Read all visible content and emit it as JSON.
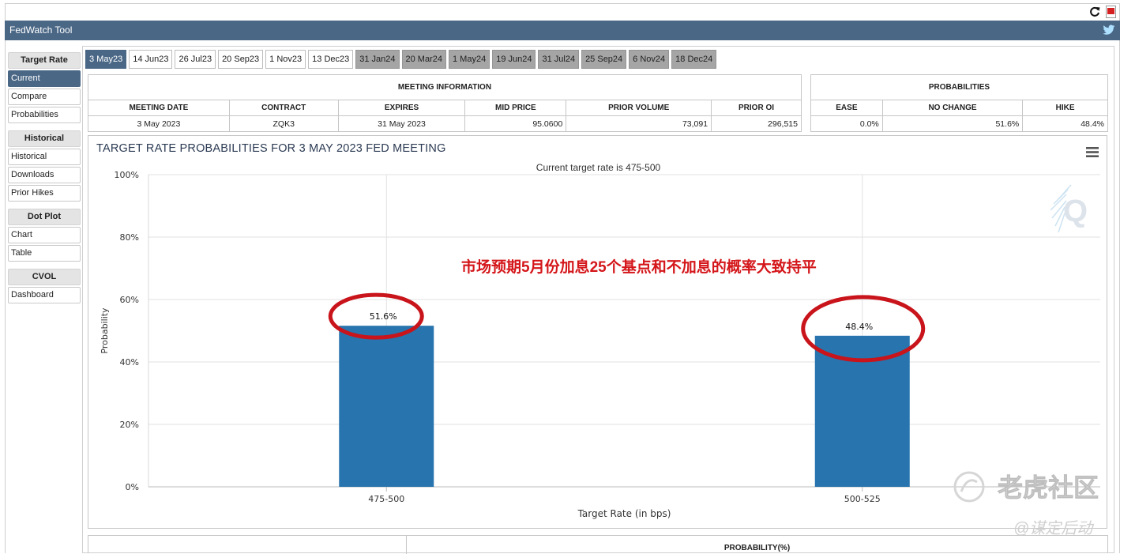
{
  "app": {
    "title": "FedWatch Tool"
  },
  "sidebar": {
    "sections": [
      {
        "heading": "Target Rate",
        "items": [
          {
            "label": "Current",
            "active": true
          },
          {
            "label": "Compare"
          },
          {
            "label": "Probabilities"
          }
        ]
      },
      {
        "heading": "Historical",
        "items": [
          {
            "label": "Historical"
          },
          {
            "label": "Downloads"
          },
          {
            "label": "Prior Hikes"
          }
        ]
      },
      {
        "heading": "Dot Plot",
        "items": [
          {
            "label": "Chart"
          },
          {
            "label": "Table"
          }
        ]
      },
      {
        "heading": "CVOL",
        "items": [
          {
            "label": "Dashboard"
          }
        ]
      }
    ]
  },
  "tabs": [
    {
      "label": "3 May23",
      "state": "active"
    },
    {
      "label": "14 Jun23",
      "state": "normal"
    },
    {
      "label": "26 Jul23",
      "state": "normal"
    },
    {
      "label": "20 Sep23",
      "state": "normal"
    },
    {
      "label": "1 Nov23",
      "state": "normal"
    },
    {
      "label": "13 Dec23",
      "state": "normal"
    },
    {
      "label": "31 Jan24",
      "state": "dim"
    },
    {
      "label": "20 Mar24",
      "state": "dim"
    },
    {
      "label": "1 May24",
      "state": "dim"
    },
    {
      "label": "19 Jun24",
      "state": "dim"
    },
    {
      "label": "31 Jul24",
      "state": "dim"
    },
    {
      "label": "25 Sep24",
      "state": "dim"
    },
    {
      "label": "6 Nov24",
      "state": "dim"
    },
    {
      "label": "18 Dec24",
      "state": "dim"
    }
  ],
  "meeting_info": {
    "heading": "MEETING INFORMATION",
    "columns": [
      "MEETING DATE",
      "CONTRACT",
      "EXPIRES",
      "MID PRICE",
      "PRIOR VOLUME",
      "PRIOR OI"
    ],
    "row": [
      "3 May 2023",
      "ZQK3",
      "31 May 2023",
      "95.0600",
      "73,091",
      "296,515"
    ]
  },
  "probabilities": {
    "heading": "PROBABILITIES",
    "columns": [
      "EASE",
      "NO CHANGE",
      "HIKE"
    ],
    "row": [
      "0.0%",
      "51.6%",
      "48.4%"
    ]
  },
  "chart_data": {
    "type": "bar",
    "title": "TARGET RATE PROBABILITIES FOR 3 MAY 2023 FED MEETING",
    "subtitle": "Current target rate is 475-500",
    "xlabel": "Target Rate (in bps)",
    "ylabel": "Probability",
    "categories": [
      "475-500",
      "500-525"
    ],
    "values": [
      51.6,
      48.4
    ],
    "data_labels": [
      "51.6%",
      "48.4%"
    ],
    "ylim": [
      0,
      100
    ],
    "yticks": [
      "0%",
      "20%",
      "40%",
      "60%",
      "80%",
      "100%"
    ],
    "grid": true,
    "bar_color": "#2874ae"
  },
  "annotation": {
    "text": "市场预期5月份加息25个基点和不加息的概率大致持平",
    "color": "#d4161a"
  },
  "watermark": {
    "name": "老虎社区",
    "handle": "@谋定后动"
  },
  "bottom_table": {
    "heading": "PROBABILITY(%)"
  }
}
